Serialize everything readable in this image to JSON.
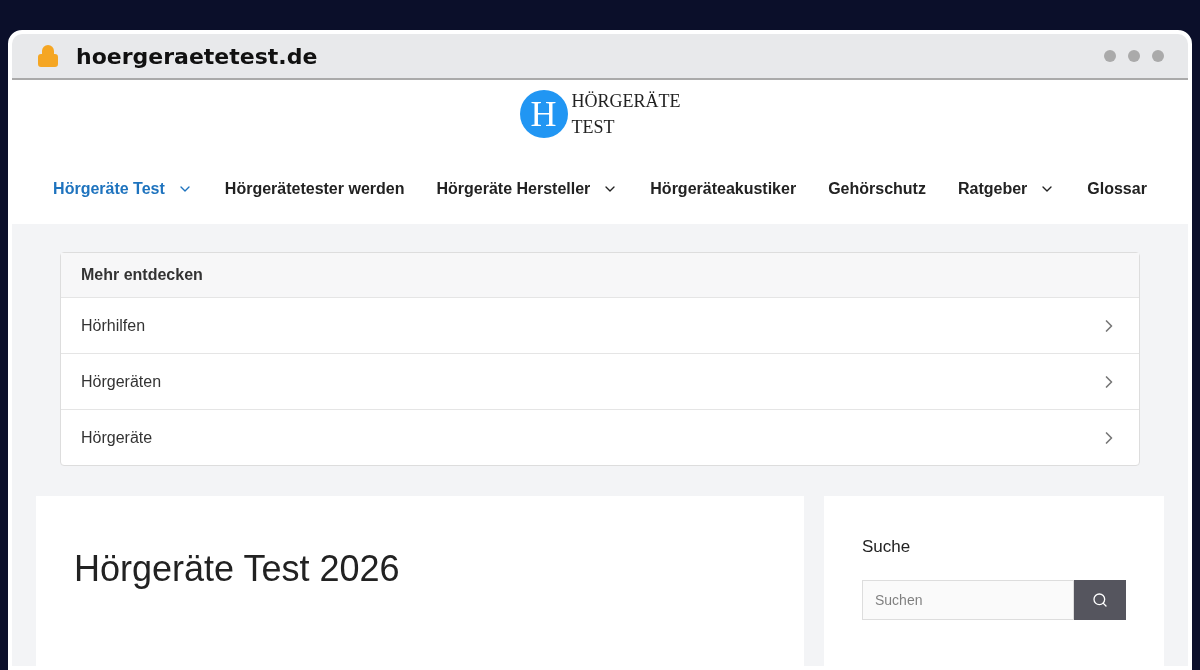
{
  "browser": {
    "address": "hoergeraetetest.de"
  },
  "logo": {
    "letter": "H",
    "lines": [
      "HÖRGERÄTE",
      "TEST"
    ]
  },
  "nav": [
    {
      "label": "Hörgeräte Test",
      "selected": true,
      "dropdown": true
    },
    {
      "label": "Hörgerätetester werden",
      "selected": false,
      "dropdown": false
    },
    {
      "label": "Hörgeräte Hersteller",
      "selected": false,
      "dropdown": true
    },
    {
      "label": "Hörgeräteakustiker",
      "selected": false,
      "dropdown": false
    },
    {
      "label": "Gehörschutz",
      "selected": false,
      "dropdown": false
    },
    {
      "label": "Ratgeber",
      "selected": false,
      "dropdown": true
    },
    {
      "label": "Glossar",
      "selected": false,
      "dropdown": false
    }
  ],
  "discover": {
    "title": "Mehr entdecken",
    "items": [
      "Hörhilfen",
      "Hörgeräten",
      "Hörgeräte"
    ]
  },
  "article": {
    "title": "Hörgeräte Test 2026"
  },
  "sidebar": {
    "title": "Suche",
    "search": {
      "placeholder": "Suchen"
    }
  }
}
